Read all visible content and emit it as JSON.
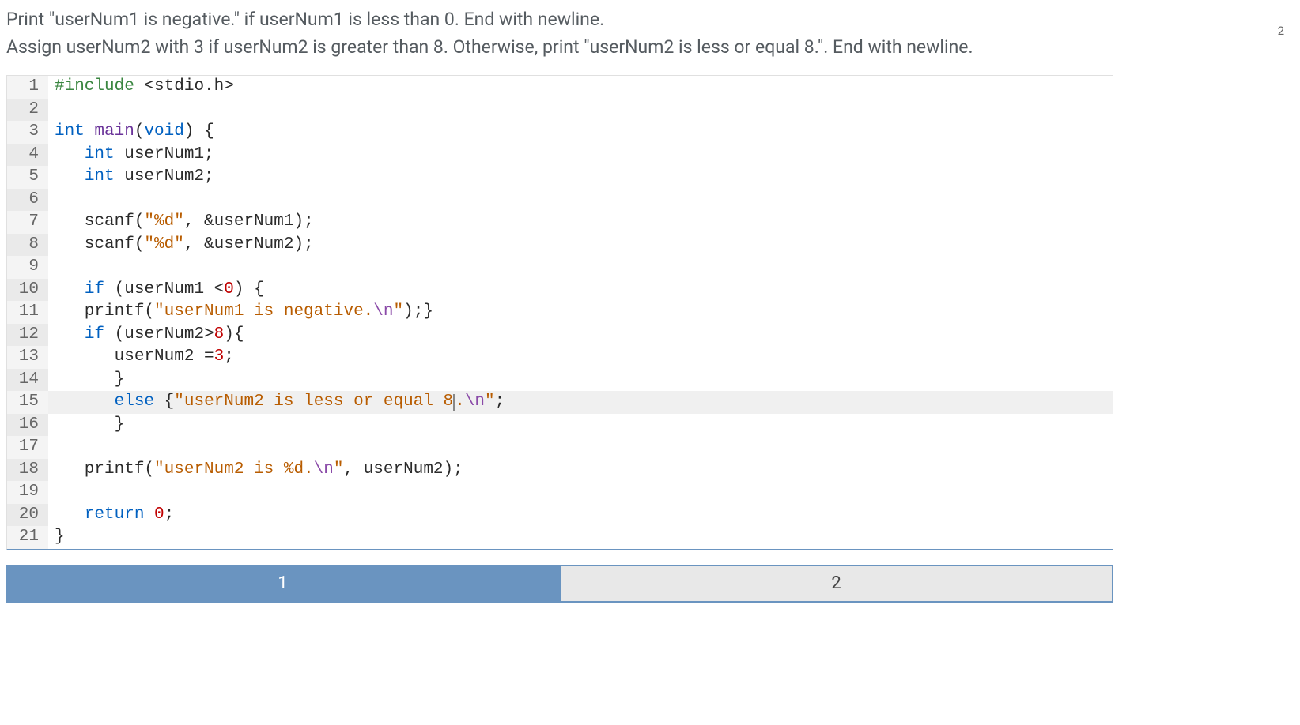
{
  "instructions": {
    "line1": "Print \"userNum1 is negative.\" if userNum1 is less than 0. End with newline.",
    "line2": "Assign userNum2 with 3 if userNum2 is greater than 8. Otherwise, print \"userNum2 is less or equal 8.\". End with newline."
  },
  "top_badge": "2",
  "code": {
    "highlighted_line": 15,
    "lines": [
      {
        "n": 1,
        "tokens": [
          {
            "c": "preproc",
            "t": "#include"
          },
          {
            "c": "plain",
            "t": " <stdio.h>"
          }
        ]
      },
      {
        "n": 2,
        "tokens": []
      },
      {
        "n": 3,
        "tokens": [
          {
            "c": "keyword",
            "t": "int"
          },
          {
            "c": "plain",
            "t": " "
          },
          {
            "c": "func",
            "t": "main"
          },
          {
            "c": "plain",
            "t": "("
          },
          {
            "c": "keyword",
            "t": "void"
          },
          {
            "c": "plain",
            "t": ") {"
          }
        ]
      },
      {
        "n": 4,
        "tokens": [
          {
            "c": "plain",
            "t": "   "
          },
          {
            "c": "keyword",
            "t": "int"
          },
          {
            "c": "plain",
            "t": " userNum1;"
          }
        ]
      },
      {
        "n": 5,
        "tokens": [
          {
            "c": "plain",
            "t": "   "
          },
          {
            "c": "keyword",
            "t": "int"
          },
          {
            "c": "plain",
            "t": " userNum2;"
          }
        ]
      },
      {
        "n": 6,
        "tokens": []
      },
      {
        "n": 7,
        "tokens": [
          {
            "c": "plain",
            "t": "   scanf("
          },
          {
            "c": "string",
            "t": "\"%d\""
          },
          {
            "c": "plain",
            "t": ", &userNum1);"
          }
        ]
      },
      {
        "n": 8,
        "tokens": [
          {
            "c": "plain",
            "t": "   scanf("
          },
          {
            "c": "string",
            "t": "\"%d\""
          },
          {
            "c": "plain",
            "t": ", &userNum2);"
          }
        ]
      },
      {
        "n": 9,
        "tokens": []
      },
      {
        "n": 10,
        "tokens": [
          {
            "c": "plain",
            "t": "   "
          },
          {
            "c": "keyword",
            "t": "if"
          },
          {
            "c": "plain",
            "t": " (userNum1 <"
          },
          {
            "c": "number",
            "t": "0"
          },
          {
            "c": "plain",
            "t": ") {"
          }
        ]
      },
      {
        "n": 11,
        "tokens": [
          {
            "c": "plain",
            "t": "   printf("
          },
          {
            "c": "string",
            "t": "\"userNum1 is negative."
          },
          {
            "c": "escape",
            "t": "\\n"
          },
          {
            "c": "string",
            "t": "\""
          },
          {
            "c": "plain",
            "t": ");}"
          }
        ]
      },
      {
        "n": 12,
        "tokens": [
          {
            "c": "plain",
            "t": "   "
          },
          {
            "c": "keyword",
            "t": "if"
          },
          {
            "c": "plain",
            "t": " (userNum2>"
          },
          {
            "c": "number",
            "t": "8"
          },
          {
            "c": "plain",
            "t": "){"
          }
        ]
      },
      {
        "n": 13,
        "tokens": [
          {
            "c": "plain",
            "t": "      userNum2 ="
          },
          {
            "c": "number",
            "t": "3"
          },
          {
            "c": "plain",
            "t": ";"
          }
        ]
      },
      {
        "n": 14,
        "tokens": [
          {
            "c": "plain",
            "t": "      }"
          }
        ]
      },
      {
        "n": 15,
        "tokens": [
          {
            "c": "plain",
            "t": "      "
          },
          {
            "c": "keyword",
            "t": "else"
          },
          {
            "c": "plain",
            "t": " {"
          },
          {
            "c": "string",
            "t": "\"userNum2 is less or equal 8"
          },
          {
            "c": "cursor",
            "t": ""
          },
          {
            "c": "string",
            "t": "."
          },
          {
            "c": "escape",
            "t": "\\n"
          },
          {
            "c": "string",
            "t": "\""
          },
          {
            "c": "plain",
            "t": ";"
          }
        ]
      },
      {
        "n": 16,
        "tokens": [
          {
            "c": "plain",
            "t": "      }"
          }
        ]
      },
      {
        "n": 17,
        "tokens": []
      },
      {
        "n": 18,
        "tokens": [
          {
            "c": "plain",
            "t": "   printf("
          },
          {
            "c": "string",
            "t": "\"userNum2 is %d."
          },
          {
            "c": "escape",
            "t": "\\n"
          },
          {
            "c": "string",
            "t": "\""
          },
          {
            "c": "plain",
            "t": ", userNum2);"
          }
        ]
      },
      {
        "n": 19,
        "tokens": []
      },
      {
        "n": 20,
        "tokens": [
          {
            "c": "plain",
            "t": "   "
          },
          {
            "c": "keyword",
            "t": "return"
          },
          {
            "c": "plain",
            "t": " "
          },
          {
            "c": "number",
            "t": "0"
          },
          {
            "c": "plain",
            "t": ";"
          }
        ]
      },
      {
        "n": 21,
        "tokens": [
          {
            "c": "plain",
            "t": "}"
          }
        ]
      }
    ]
  },
  "tabs": {
    "active_index": 0,
    "items": [
      {
        "label": "1"
      },
      {
        "label": "2"
      }
    ]
  }
}
